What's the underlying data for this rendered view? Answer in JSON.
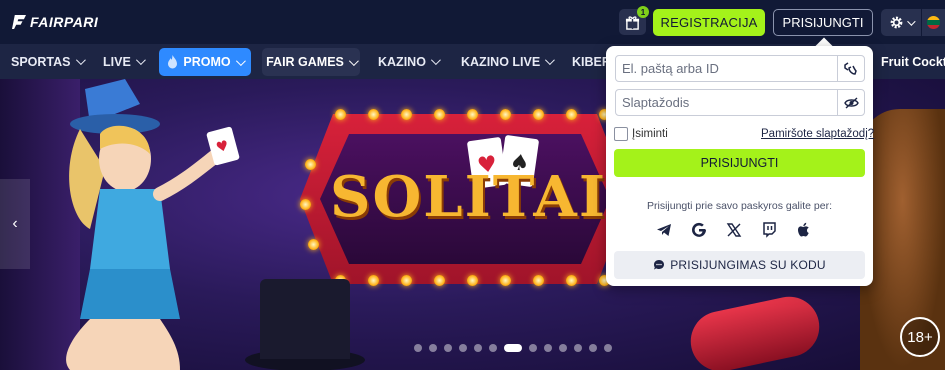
{
  "header": {
    "logo_text": "FAIRPARI",
    "gift_badge": "1",
    "register_label": "REGISTRACIJA",
    "login_label": "PRISIJUNGTI",
    "flag_colors": [
      "#fdb913",
      "#006a44",
      "#c1272d"
    ]
  },
  "nav": {
    "items": [
      {
        "label": "SPORTAS"
      },
      {
        "label": "LIVE"
      },
      {
        "label": "PROMO"
      },
      {
        "label": "FAIR GAMES"
      },
      {
        "label": "KAZINO"
      },
      {
        "label": "KAZINO LIVE"
      },
      {
        "label": "KIBER"
      },
      {
        "label": "Fruit Cockta"
      }
    ],
    "promo_icon": "fire-icon"
  },
  "hero": {
    "banner_title": "SOLITAIR",
    "age_badge": "18+",
    "slide_count": 13,
    "active_slide": 7
  },
  "login_popup": {
    "email_placeholder": "El. paštą arba ID",
    "password_placeholder": "Slaptažodis",
    "remember_label": "Įsiminti",
    "forgot_label": "Pamiršote slaptažodį?",
    "submit_label": "PRISIJUNGTI",
    "social_caption": "Prisijungti prie savo paskyros galite per:",
    "social_icons": [
      "telegram-icon",
      "google-icon",
      "x-icon",
      "twitch-icon",
      "apple-icon"
    ],
    "code_login_label": "PRISIJUNGIMAS SU KODU"
  },
  "colors": {
    "accent_green": "#a4f21a",
    "promo_blue": "#2e8aff",
    "header_bg": "#111936"
  }
}
